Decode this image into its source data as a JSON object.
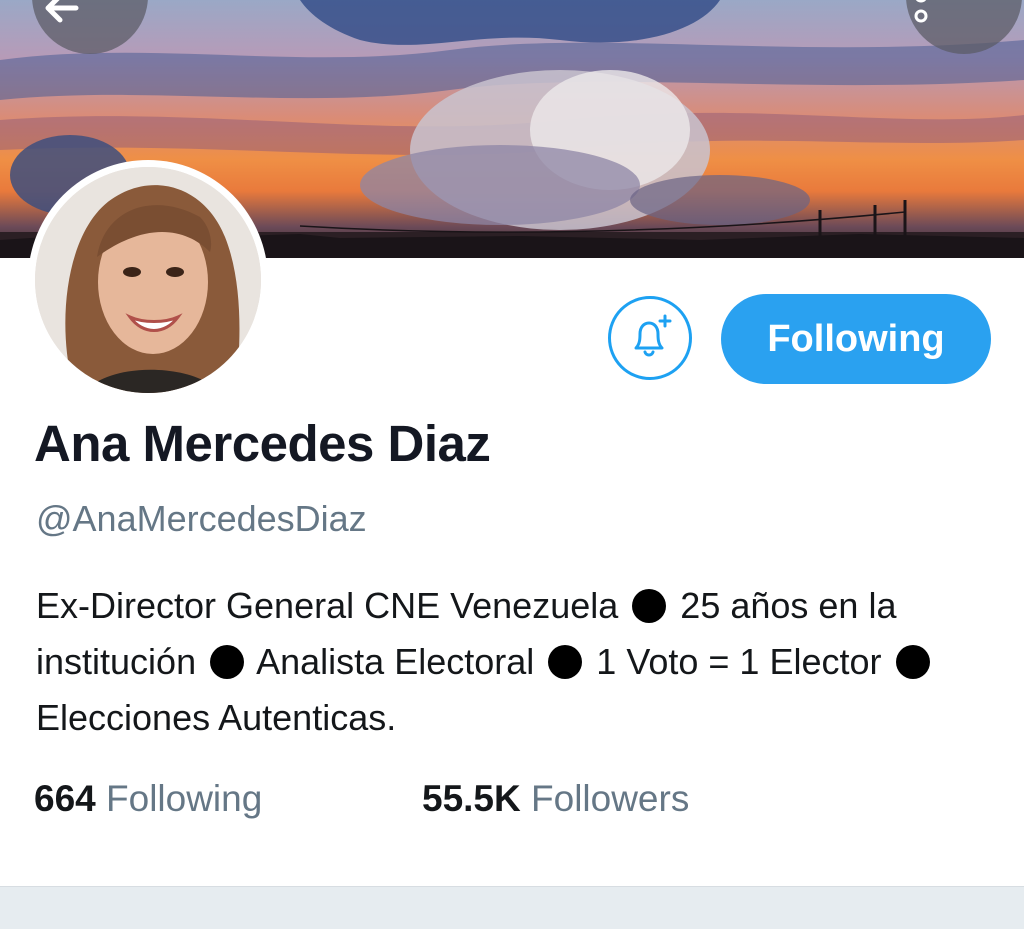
{
  "profile": {
    "name": "Ana Mercedes Diaz",
    "handle": "@AnaMercedesDiaz",
    "bio": {
      "part1": "Ex-Director General CNE Venezuela",
      "part2": "25 años en la institución",
      "part3": "Analista Electoral",
      "part4": "1 Voto = 1 Elector",
      "part5": "Elecciones Autenticas."
    }
  },
  "actions": {
    "follow_label": "Following",
    "notify_icon": "bell-plus-icon",
    "back_icon": "arrow-left-icon",
    "more_icon": "more-vertical-icon"
  },
  "stats": {
    "following_count": "664",
    "following_label": "Following",
    "followers_count": "55.5K",
    "followers_label": "Followers"
  },
  "colors": {
    "accent": "#1da1f2",
    "secondary_text": "#657786",
    "primary_text": "#14171a"
  }
}
